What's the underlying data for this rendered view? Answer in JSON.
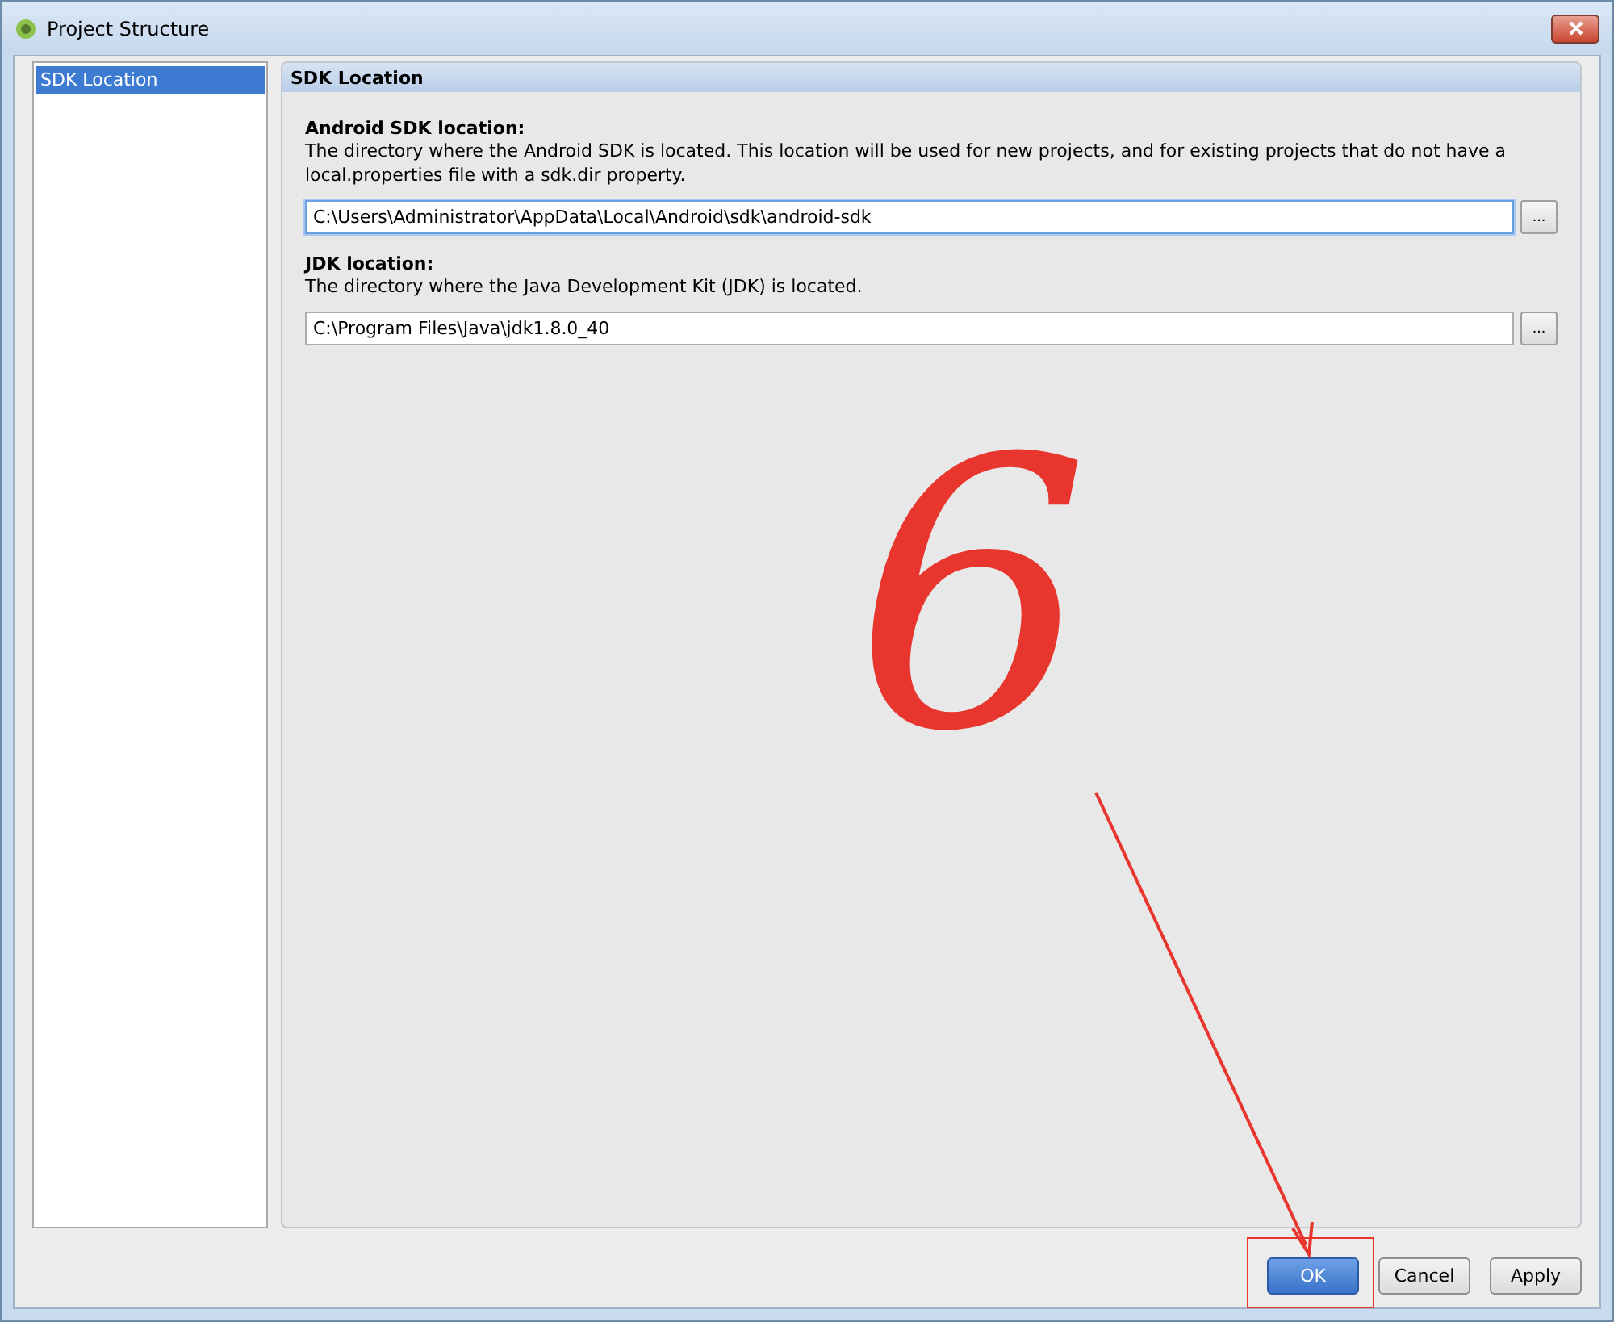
{
  "window": {
    "title": "Project Structure"
  },
  "sidebar": {
    "items": [
      {
        "label": "SDK Location",
        "selected": true
      }
    ]
  },
  "panel": {
    "title": "SDK Location",
    "sections": [
      {
        "heading": "Android SDK location:",
        "description": "The directory where the Android SDK is located. This location will be used for new projects, and for existing projects that do not have a local.properties file with a sdk.dir property.",
        "value": "C:\\Users\\Administrator\\AppData\\Local\\Android\\sdk\\android-sdk",
        "focused": true,
        "browse": "..."
      },
      {
        "heading": "JDK location:",
        "description": "The directory where the Java Development Kit (JDK) is located.",
        "value": "C:\\Program Files\\Java\\jdk1.8.0_40",
        "focused": false,
        "browse": "..."
      }
    ]
  },
  "buttons": [
    {
      "label": "OK",
      "default": true
    },
    {
      "label": "Cancel",
      "default": false
    },
    {
      "label": "Apply",
      "default": false
    }
  ],
  "annotation": {
    "text": "6"
  }
}
